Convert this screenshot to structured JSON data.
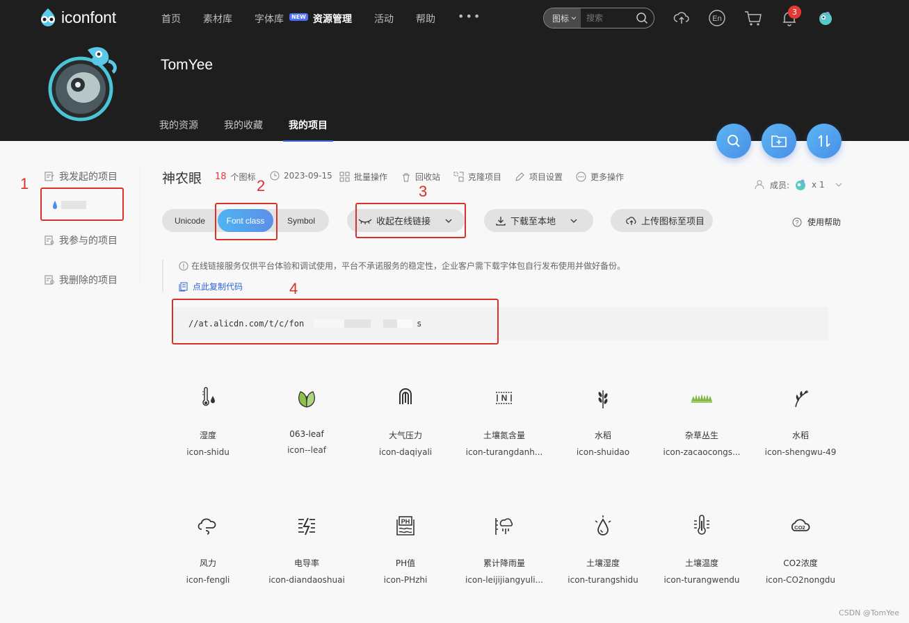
{
  "brand": {
    "name": "iconfont"
  },
  "nav": {
    "items": [
      "首页",
      "素材库",
      "字体库",
      "资源管理",
      "活动",
      "帮助"
    ],
    "new_badge": "NEW",
    "more": "•••"
  },
  "search": {
    "type": "图标",
    "placeholder": "搜索"
  },
  "notifications": {
    "count": "3"
  },
  "profile": {
    "name": "TomYee",
    "tabs": [
      "我的资源",
      "我的收藏",
      "我的项目"
    ]
  },
  "sidebar": {
    "items": [
      "我发起的项目",
      "我参与的项目",
      "我删除的项目"
    ]
  },
  "project": {
    "title": "神农眼",
    "icon_count": "18",
    "icon_count_unit": "个图标",
    "date": "2023-09-15",
    "actions": [
      "批量操作",
      "回收站",
      "克隆项目",
      "项目设置",
      "更多操作"
    ],
    "members_label": "成员:",
    "members_count": "x 1"
  },
  "format_tabs": [
    "Unicode",
    "Font class",
    "Symbol"
  ],
  "buttons": {
    "online_link": "收起在线链接",
    "download": "下载至本地",
    "upload": "上传图标至项目",
    "help": "使用帮助"
  },
  "notice": "在线链接服务仅供平台体验和调试使用，平台不承诺服务的稳定性，企业客户需下载字体包自行发布使用并做好备份。",
  "copy_code": "点此复制代码",
  "code": {
    "prefix": "//at.alicdn.com/t/c/fon",
    "suffix": "s"
  },
  "annotations": [
    "1",
    "2",
    "3",
    "4"
  ],
  "icons": [
    {
      "name": "湿度",
      "code": "icon-shidu",
      "icon": "thermometer-drop-icon"
    },
    {
      "name": "063-leaf",
      "code": "icon--leaf",
      "icon": "leaf-icon"
    },
    {
      "name": "大气压力",
      "code": "icon-daqiyali",
      "icon": "pressure-icon"
    },
    {
      "name": "土壤氮含量",
      "code": "icon-turangdanh...",
      "icon": "soil-nitrogen-icon"
    },
    {
      "name": "水稻",
      "code": "icon-shuidao",
      "icon": "rice-icon"
    },
    {
      "name": "杂草丛生",
      "code": "icon-zacaocongs...",
      "icon": "grass-icon"
    },
    {
      "name": "水稻",
      "code": "icon-shengwu-49",
      "icon": "rice-plant-icon"
    },
    {
      "name": "风力",
      "code": "icon-fengli",
      "icon": "wind-icon"
    },
    {
      "name": "电导率",
      "code": "icon-diandaoshuai",
      "icon": "conductivity-icon"
    },
    {
      "name": "PH值",
      "code": "icon-PHzhi",
      "icon": "ph-icon"
    },
    {
      "name": "累计降雨量",
      "code": "icon-leijijiangyuli...",
      "icon": "rainfall-icon"
    },
    {
      "name": "土壤湿度",
      "code": "icon-turangshidu",
      "icon": "soil-humidity-icon"
    },
    {
      "name": "土壤温度",
      "code": "icon-turangwendu",
      "icon": "soil-temperature-icon"
    },
    {
      "name": "CO2浓度",
      "code": "icon-CO2nongdu",
      "icon": "co2-icon"
    }
  ],
  "watermark": "CSDN @TomYee",
  "colors": {
    "header_bg": "#1e1e1e",
    "accent": "#4a8ee8",
    "annotation": "#d9302a",
    "notify": "#e53935",
    "link": "#2b63d9"
  }
}
